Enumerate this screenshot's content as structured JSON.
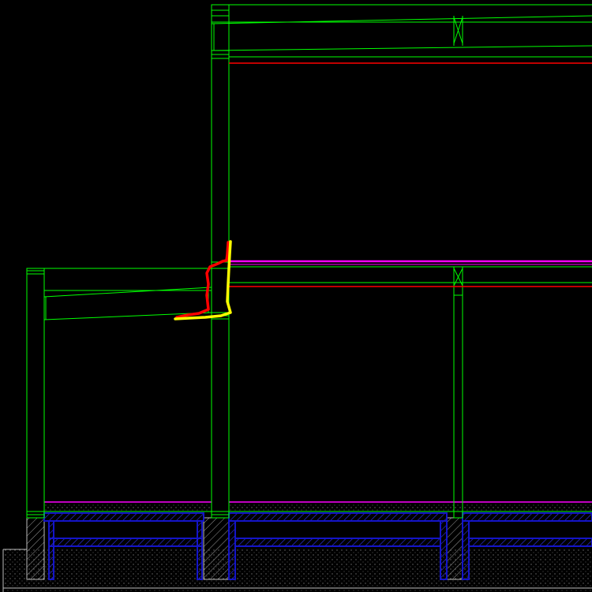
{
  "drawing": {
    "background": "#000000",
    "layer_colors": {
      "structure": "#00ff00",
      "section_line": "#ff0000",
      "floor_finish": "#ff00ff",
      "foundation": "#0000cc",
      "foundation_hatch": "#6666ff",
      "ground_hatch": "#aaaaaa",
      "markup_red": "#ff0000",
      "markup_yellow": "#ffff00"
    },
    "markups": [
      {
        "name": "red-markup-stroke",
        "color": "#ff0000"
      },
      {
        "name": "yellow-markup-stroke",
        "color": "#ffff00"
      }
    ]
  }
}
